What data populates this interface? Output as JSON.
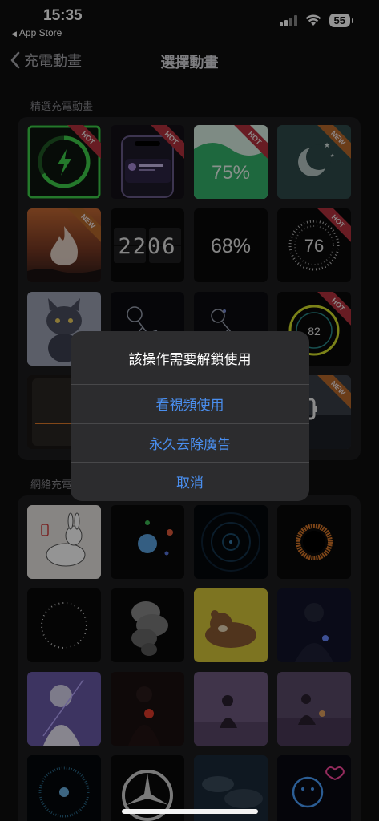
{
  "status_bar": {
    "time": "15:35",
    "back_app": "App Store",
    "battery": "55",
    "icons": [
      "signal-icon",
      "wifi-icon",
      "battery-icon"
    ]
  },
  "nav": {
    "back_label": "充電動畫",
    "title": "選擇動畫"
  },
  "sections": {
    "featured": "精選充電動畫",
    "online": "網絡充電"
  },
  "featured_tiles": [
    {
      "name": "lightning-ring",
      "badge": "HOT",
      "text": ""
    },
    {
      "name": "iphone-mockup",
      "badge": "HOT",
      "text": ""
    },
    {
      "name": "green-wave",
      "badge": "HOT",
      "text": "75%"
    },
    {
      "name": "moon-night",
      "badge": "NEW",
      "text": ""
    },
    {
      "name": "flame-sunset",
      "badge": "NEW",
      "text": ""
    },
    {
      "name": "flip-clock",
      "badge": "",
      "text": "2206"
    },
    {
      "name": "percent-plain",
      "badge": "",
      "text": "68%"
    },
    {
      "name": "dotted-ring",
      "badge": "HOT",
      "text": "76"
    },
    {
      "name": "angry-cat",
      "badge": "",
      "text": ""
    },
    {
      "name": "astronaut-1",
      "badge": "",
      "text": ""
    },
    {
      "name": "astronaut-2",
      "badge": "",
      "text": ""
    },
    {
      "name": "neon-ring",
      "badge": "HOT",
      "text": "82"
    },
    {
      "name": "dark-device",
      "badge": "",
      "text": ""
    },
    {
      "name": "hidden-2",
      "badge": "",
      "text": ""
    },
    {
      "name": "hidden-3",
      "badge": "",
      "text": ""
    },
    {
      "name": "battery-city",
      "badge": "NEW",
      "text": ""
    }
  ],
  "online_tiles": [
    "bunny-sketch",
    "orbit-dots",
    "blue-ripple",
    "orange-eclipse",
    "dotted-circle",
    "smoke",
    "brown-bear",
    "night-girl",
    "anime-girl-purple",
    "dark-figure-red",
    "girl-sitting",
    "couple-sitting",
    "particle-ring",
    "mercedes-logo",
    "cloudy-sky",
    "neon-doodle"
  ],
  "dialog": {
    "title": "該操作需要解鎖使用",
    "option_watch_video": "看視頻使用",
    "option_remove_ads": "永久去除廣告",
    "option_cancel": "取消"
  },
  "colors": {
    "accent_blue": "#4a8ff0",
    "hot_ribbon": "#b3313d",
    "new_ribbon": "#b86a2c",
    "green_ring": "#3fcf4a"
  }
}
